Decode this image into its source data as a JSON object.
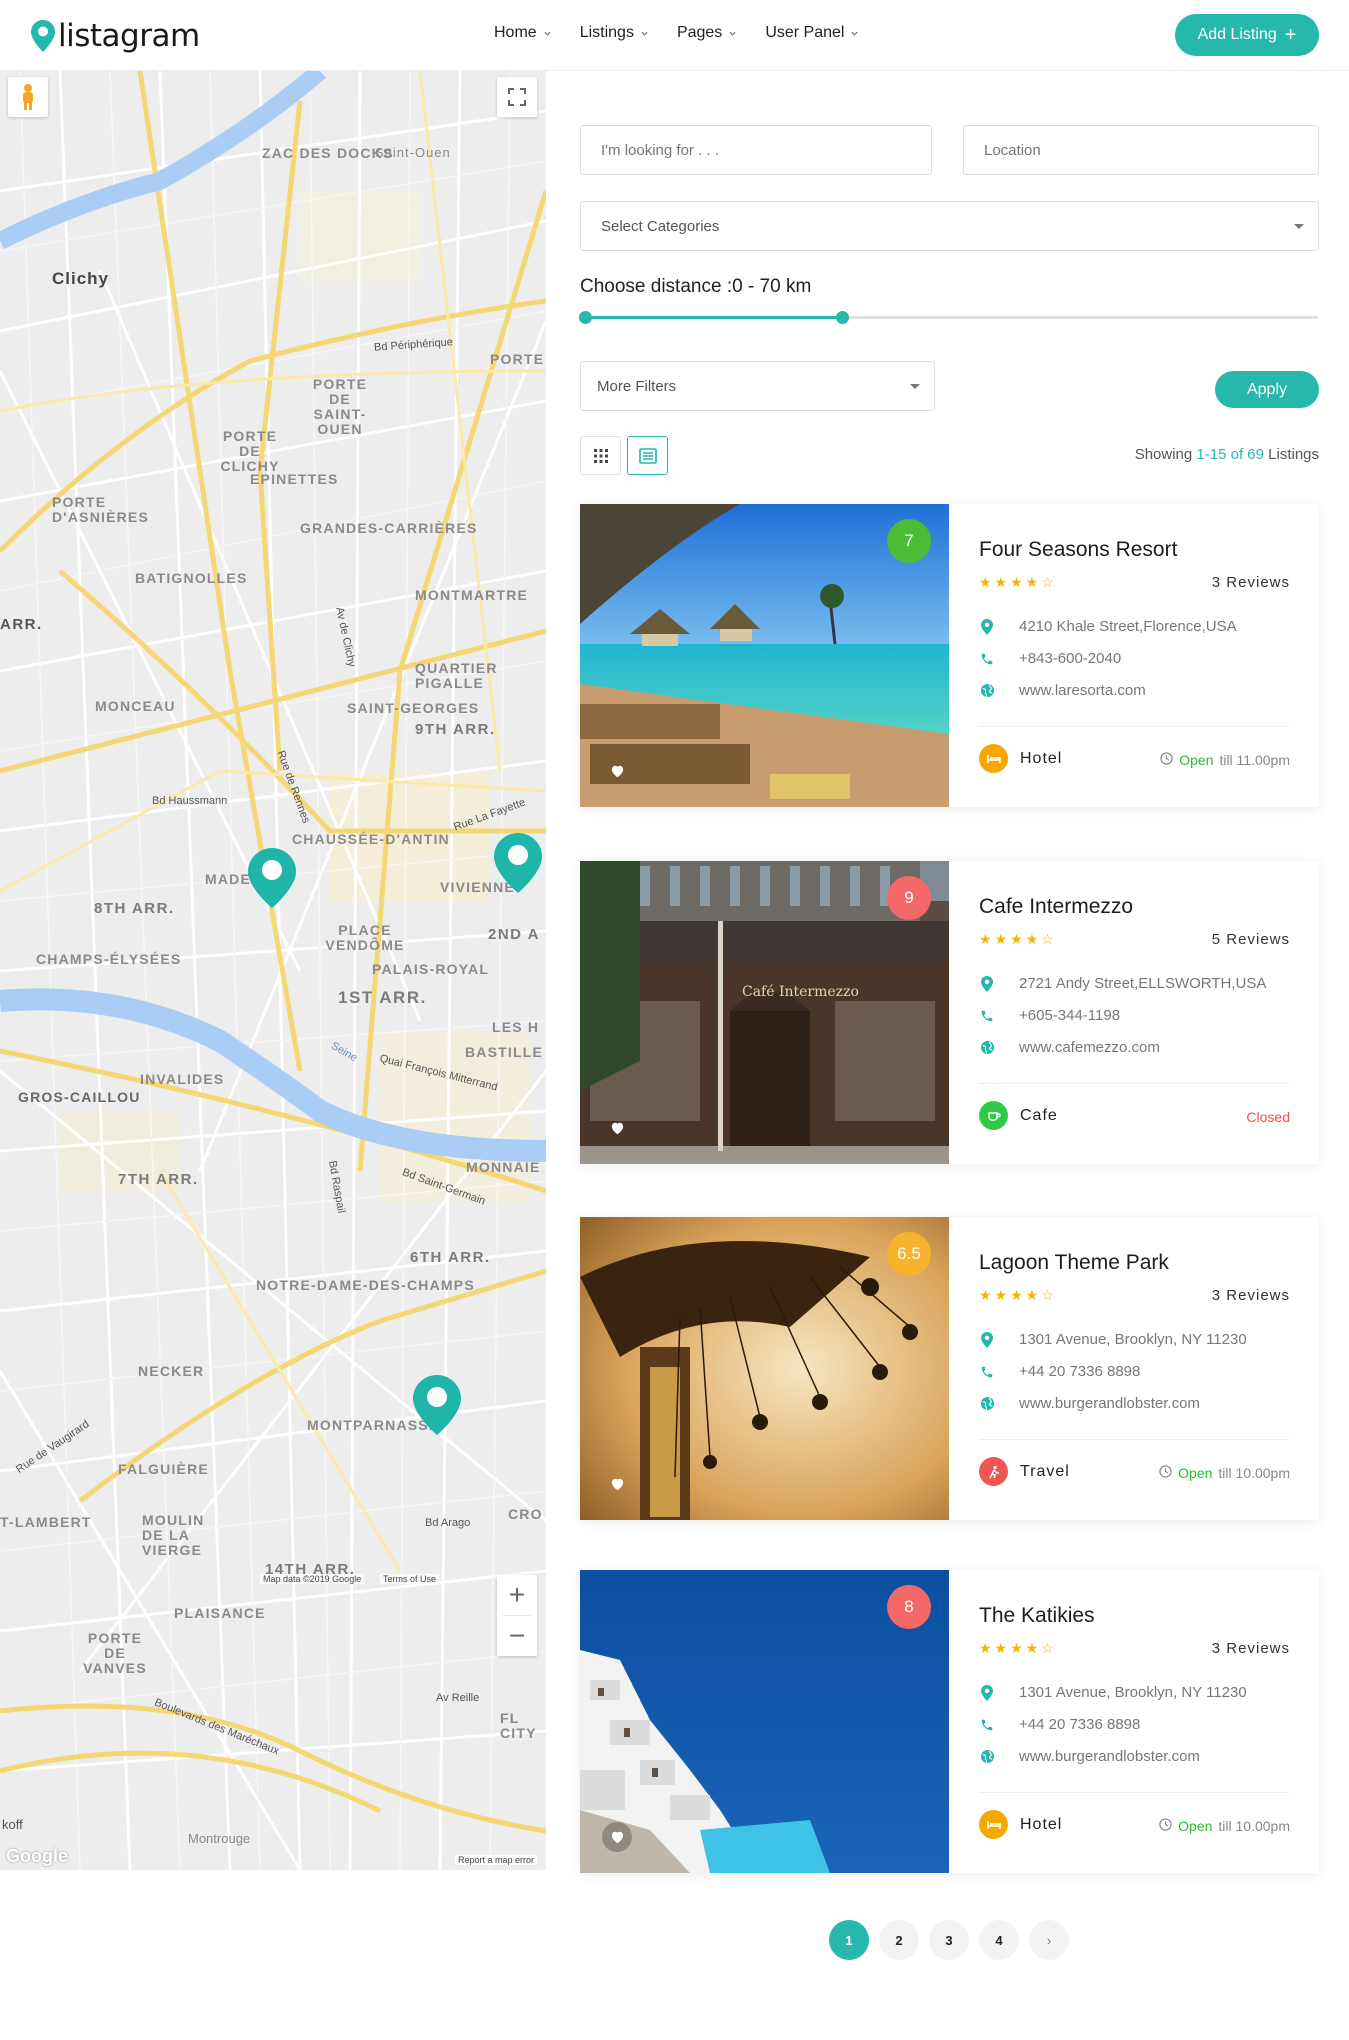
{
  "brand": {
    "name": "listagram",
    "accent": "#26b8ad"
  },
  "nav": {
    "items": [
      {
        "label": "Home"
      },
      {
        "label": "Listings"
      },
      {
        "label": "Pages"
      },
      {
        "label": "User Panel"
      }
    ],
    "add_listing_label": "Add Listing"
  },
  "map": {
    "labels": [
      "ZAC DES DOCKS",
      "Saint-Ouen",
      "Clichy",
      "PORTE DE SAINT-OUEN",
      "PORTE CLIGNANCO",
      "PORTE DE CLICHY",
      "EPINETTES",
      "PORTE D'ASNIÈRES",
      "GRANDES-CARRIÈRES",
      "BATIGNOLLES",
      "MONTMARTRE",
      "ARR.",
      "QUARTIER PIGALLE",
      "MONCEAU",
      "SAINT-GEORGES",
      "9TH ARR.",
      "CHAUSSÉE-D'ANTIN",
      "MADE",
      "VIVIENNE",
      "8TH ARR.",
      "PLACE VENDÔME",
      "2ND A",
      "CHAMPS-ÉLYSÉES",
      "PALAIS-ROYAL",
      "1ST ARR.",
      "LES H",
      "BASTILLE",
      "INVALIDES",
      "GROS-CAILLOU",
      "MONNAIE",
      "7TH ARR.",
      "6TH ARR.",
      "NOTRE-DAME-DES-CHAMPS",
      "NECKER",
      "MONTPARNASSE",
      "FALGUIÈRE",
      "MOULIN DE LA VIERGE",
      "T-LAMBERT",
      "CRO",
      "14TH ARR.",
      "PLAISANCE",
      "PORTE DE VANVES",
      "FL CITY",
      "Montrouge",
      "koff"
    ],
    "streets": [
      "Bd Périphérique",
      "Boulevards des Maréchaux",
      "Rue de Rennes",
      "Bd Haussmann",
      "Seine",
      "Quai François Mitterrand",
      "Bd Raspail",
      "Bd Saint-Germain",
      "Av de Clichy",
      "Rue La Fayette",
      "Rue de Vaugirard",
      "Bd Arago",
      "Av Reille"
    ],
    "attribution": "Map data ©2019 Google",
    "terms": "Terms of Use",
    "report": "Report a map error",
    "google": "Google",
    "zoom_in": "+",
    "zoom_out": "−"
  },
  "search": {
    "keyword_placeholder": "I'm looking for . . .",
    "location_placeholder": "Location",
    "category_placeholder": "Select Categories",
    "distance_label": "Choose distance :0 - 70 km",
    "distance_min": 0,
    "distance_max": 70,
    "distance_fraction": 0.35,
    "more_filters": "More Filters",
    "apply_label": "Apply"
  },
  "results": {
    "prefix": "Showing",
    "range": "1-15 of 69",
    "suffix": "Listings"
  },
  "listings": [
    {
      "title": "Four Seasons Resort",
      "rating": "7",
      "rating_color": "#4cbb35",
      "stars": "★★★★☆",
      "reviews": "3 Reviews",
      "address": "4210 Khale Street,Florence,USA",
      "phone": "+843-600-2040",
      "website": "www.laresorta.com",
      "category": "Hotel",
      "category_color": "#f7a800",
      "status_open": "Open",
      "status_rest": "till 11.00pm"
    },
    {
      "title": "Cafe Intermezzo",
      "rating": "9",
      "rating_color": "#f46868",
      "stars": "★★★★☆",
      "reviews": "5 Reviews",
      "address": "2721 Andy Street,ELLSWORTH,USA",
      "phone": "+605-344-1198",
      "website": "www.cafemezzo.com",
      "category": "Cafe",
      "category_color": "#2fcb48",
      "status_closed": "Closed"
    },
    {
      "title": "Lagoon Theme Park",
      "rating": "6.5",
      "rating_color": "#f7b32b",
      "stars": "★★★★☆",
      "reviews": "3 Reviews",
      "address": "1301 Avenue, Brooklyn, NY 11230",
      "phone": "+44 20 7336 8898",
      "website": "www.burgerandlobster.com",
      "category": "Travel",
      "category_color": "#f05555",
      "status_open": "Open",
      "status_rest": "till 10.00pm"
    },
    {
      "title": "The Katikies",
      "rating": "8",
      "rating_color": "#f46868",
      "stars": "★★★★☆",
      "reviews": "3 Reviews",
      "address": "1301 Avenue, Brooklyn, NY 11230",
      "phone": "+44 20 7336 8898",
      "website": "www.burgerandlobster.com",
      "category": "Hotel",
      "category_color": "#f7a800",
      "status_open": "Open",
      "status_rest": "till 10.00pm"
    }
  ],
  "image_text": {
    "cafe_sign": "Café Intermezzo"
  },
  "pagination": {
    "pages": [
      "1",
      "2",
      "3",
      "4"
    ],
    "next": "›",
    "current": "1"
  }
}
